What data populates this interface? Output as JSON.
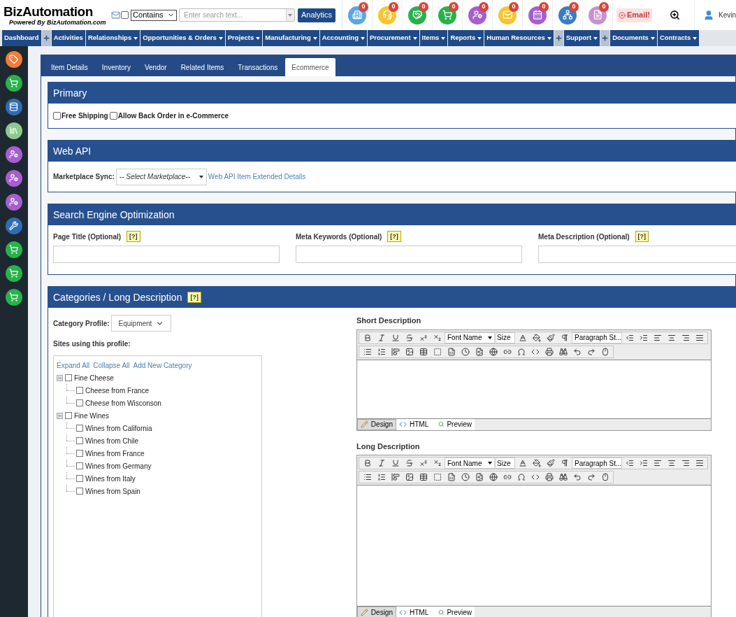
{
  "header": {
    "logo": {
      "name": "BizAutomation",
      "tagline": "Powered By BizAutomation.com"
    },
    "mail_checkbox": {
      "checked": false
    },
    "match_select": "Contains",
    "search": {
      "placeholder": "Enter search text..."
    },
    "analytics_button": "Analytics",
    "shortcuts": [
      {
        "kind": "building",
        "color": "#5aa6e6",
        "badge": "0"
      },
      {
        "kind": "headset",
        "color": "#f7c531",
        "badge": "0"
      },
      {
        "kind": "handshake",
        "color": "#27b24a",
        "badge": "0"
      },
      {
        "kind": "cart",
        "color": "#27b24a",
        "badge": "0"
      },
      {
        "kind": "person",
        "color": "#a65fcf",
        "badge": "0"
      },
      {
        "kind": "mail",
        "color": "#f7c531",
        "badge": "0"
      },
      {
        "kind": "calendar",
        "color": "#a65fcf",
        "badge": "0"
      },
      {
        "kind": "org",
        "color": "#3b7cc4",
        "badge": "0"
      },
      {
        "kind": "document",
        "color": "#c98fd1",
        "badge": "0"
      }
    ],
    "email_alert": "Email!",
    "user": "Kevin"
  },
  "nav": [
    {
      "kind": "menu",
      "label": "Dashboard",
      "caret": false
    },
    {
      "kind": "plus"
    },
    {
      "kind": "menu",
      "label": "Activities",
      "caret": false
    },
    {
      "kind": "menu",
      "label": "Relationships",
      "caret": true
    },
    {
      "kind": "menu",
      "label": "Opportunities & Orders",
      "caret": true
    },
    {
      "kind": "menu",
      "label": "Projects",
      "caret": true
    },
    {
      "kind": "menu",
      "label": "Manufacturing",
      "caret": true
    },
    {
      "kind": "menu",
      "label": "Accounting",
      "caret": true
    },
    {
      "kind": "menu",
      "label": "Procurement",
      "caret": true
    },
    {
      "kind": "menu",
      "label": "Items",
      "caret": true
    },
    {
      "kind": "menu",
      "label": "Reports",
      "caret": true
    },
    {
      "kind": "menu",
      "label": "Human Resources",
      "caret": true
    },
    {
      "kind": "plus"
    },
    {
      "kind": "menu",
      "label": "Support",
      "caret": true
    },
    {
      "kind": "plus"
    },
    {
      "kind": "menu",
      "label": "Documents",
      "caret": true
    },
    {
      "kind": "menu",
      "label": "Contracts",
      "caret": true
    }
  ],
  "sidebar": [
    {
      "kind": "tag",
      "color": "#f07e3a"
    },
    {
      "kind": "cart",
      "color": "#27b24a"
    },
    {
      "kind": "database",
      "color": "#2f6db3"
    },
    {
      "kind": "binders",
      "color": "#8cc98f"
    },
    {
      "kind": "person",
      "color": "#a65fcf"
    },
    {
      "kind": "person",
      "color": "#a65fcf"
    },
    {
      "kind": "person",
      "color": "#a65fcf"
    },
    {
      "kind": "tools",
      "color": "#2f6db3"
    },
    {
      "kind": "cart",
      "color": "#27b24a"
    },
    {
      "kind": "cart",
      "color": "#27b24a"
    },
    {
      "kind": "cart",
      "color": "#27b24a"
    }
  ],
  "tabs": [
    {
      "label": "Item Details",
      "selected": false
    },
    {
      "label": "Inventory",
      "selected": false
    },
    {
      "label": "Vendor",
      "selected": false
    },
    {
      "label": "Related Items",
      "selected": false
    },
    {
      "label": "Transactions",
      "selected": false
    },
    {
      "label": "Ecommerce",
      "selected": true
    }
  ],
  "primary": {
    "title": "Primary",
    "options": [
      {
        "label": "Free Shipping",
        "checked": false
      },
      {
        "label": "Allow Back Order in e-Commerce",
        "checked": false
      }
    ]
  },
  "web_api": {
    "title": "Web API",
    "label": "Marketplace Sync:",
    "select": "-- Select Marketplace--",
    "link": "Web API Item Extended Details"
  },
  "seo": {
    "title": "Search Engine Optimization",
    "fields": [
      {
        "label": "Page Title (Optional)",
        "help": "[?]"
      },
      {
        "label": "Meta Keywords (Optional)",
        "help": "[?]"
      },
      {
        "label": "Meta Description (Optional)",
        "help": "[?]"
      }
    ]
  },
  "categories": {
    "title": "Categories / Long Description",
    "help": "[?]",
    "profile_label": "Category Profile:",
    "profile": "Equipment",
    "sites_label": "Sites using this profile:",
    "actions": [
      "Expand All",
      "Collapse All",
      "Add New Category"
    ],
    "tree": [
      {
        "label": "Fine Cheese",
        "checked": false,
        "expanded": true,
        "children": [
          {
            "label": "Cheese from France",
            "checked": false
          },
          {
            "label": "Cheese from Wisconson",
            "checked": false
          }
        ]
      },
      {
        "label": "Fine Wines",
        "checked": false,
        "expanded": true,
        "children": [
          {
            "label": "Wines from California",
            "checked": false
          },
          {
            "label": "Wines from Chile",
            "checked": false
          },
          {
            "label": "Wines from France",
            "checked": false
          },
          {
            "label": "Wines from Germany",
            "checked": false
          },
          {
            "label": "Wines from Italy",
            "checked": false
          },
          {
            "label": "Wines from Spain",
            "checked": false
          }
        ]
      }
    ]
  },
  "editors": [
    {
      "label": "Short Description",
      "font_name": "Font Name",
      "size": "Size",
      "paragraph": "Paragraph St...",
      "modes": [
        {
          "kind": "design",
          "label": "Design",
          "selected": true
        },
        {
          "kind": "html",
          "label": "HTML",
          "selected": false
        },
        {
          "kind": "preview",
          "label": "Preview",
          "selected": false
        }
      ]
    },
    {
      "label": "Long Description",
      "font_name": "Font Name",
      "size": "Size",
      "paragraph": "Paragraph St...",
      "modes": [
        {
          "kind": "design",
          "label": "Design",
          "selected": true
        },
        {
          "kind": "html",
          "label": "HTML",
          "selected": false
        },
        {
          "kind": "preview",
          "label": "Preview",
          "selected": false
        }
      ]
    }
  ]
}
